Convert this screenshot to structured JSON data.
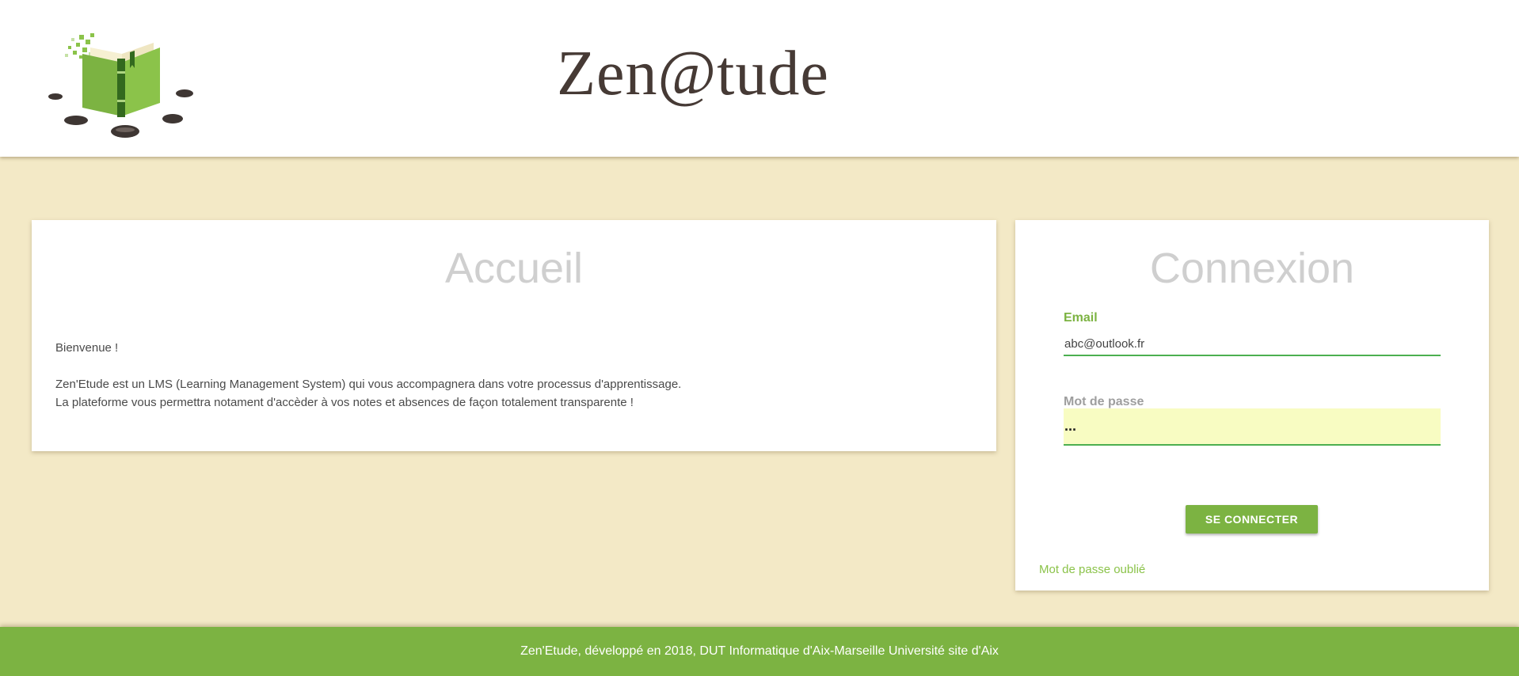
{
  "header": {
    "logo": "book-logo",
    "brand_title": "Zen@tude"
  },
  "accueil": {
    "title": "Accueil",
    "greeting": "Bienvenue !",
    "line1": "Zen'Etude est un LMS (Learning Management System) qui vous accompagnera dans votre processus d'apprentissage.",
    "line2": "La plateforme vous permettra notament d'accèder à vos notes et absences de façon totalement transparente !"
  },
  "connexion": {
    "title": "Connexion",
    "email_label": "Email",
    "email_value": "abc@outlook.fr",
    "password_label": "Mot de passe",
    "password_value": "...",
    "submit_label": "SE CONNECTER",
    "forgot_label": "Mot de passe oublié"
  },
  "footer": {
    "text": "Zen'Etude, développé en 2018, DUT Informatique d'Aix-Marseille Université site d'Aix"
  },
  "colors": {
    "background": "#f3e9c6",
    "accent": "#7cb342",
    "input_underline": "#4caf50",
    "autofill": "#f8fcc2",
    "brand_text": "#463a35"
  }
}
